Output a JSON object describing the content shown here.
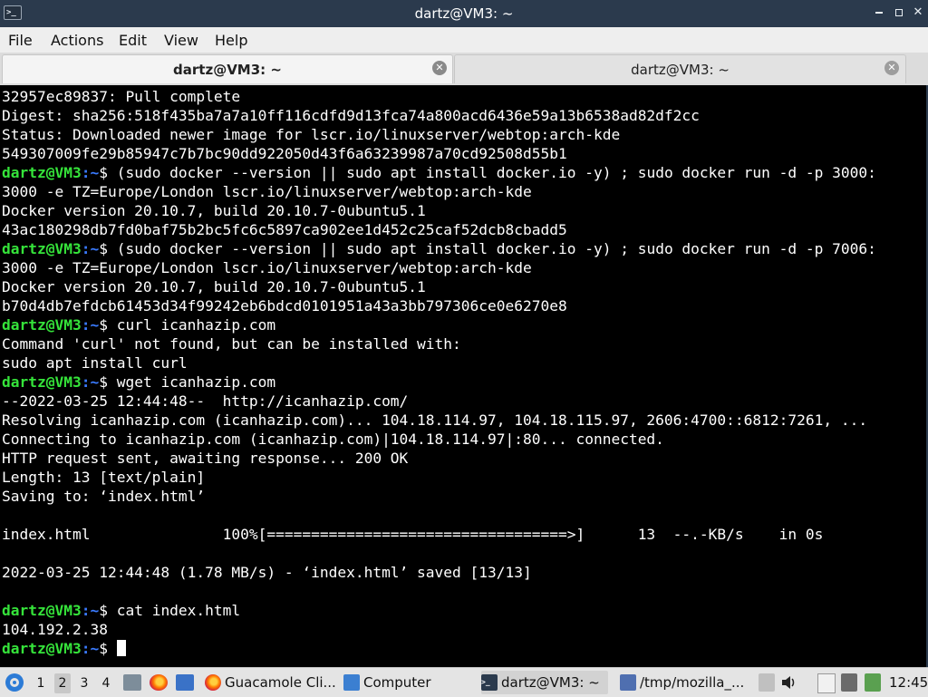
{
  "window": {
    "title": "dartz@VM3: ~",
    "app_icon_text": ">_",
    "controls": [
      "minimize-icon",
      "maximize-icon",
      "close-icon"
    ]
  },
  "menu": {
    "items": [
      "File",
      "Actions",
      "Edit",
      "View",
      "Help"
    ]
  },
  "tabs": [
    {
      "label": "dartz@VM3: ~",
      "active": true
    },
    {
      "label": "dartz@VM3: ~",
      "active": false
    }
  ],
  "terminal": {
    "colors": {
      "prompt_user": "#35e33a",
      "prompt_path": "#3a7bff",
      "text": "#ffffff",
      "background": "#000000"
    },
    "lines": [
      {
        "type": "out",
        "text": "32957ec89837: Pull complete"
      },
      {
        "type": "out",
        "text": "Digest: sha256:518f435ba7a7a10ff116cdfd9d13fca74a800acd6436e59a13b6538ad82df2cc"
      },
      {
        "type": "out",
        "text": "Status: Downloaded newer image for lscr.io/linuxserver/webtop:arch-kde"
      },
      {
        "type": "out",
        "text": "549307009fe29b85947c7b7bc90dd922050d43f6a63239987a70cd92508d55b1"
      },
      {
        "type": "prompt",
        "user": "dartz@VM3",
        "path": ":~",
        "cmd": "$ (sudo docker --version || sudo apt install docker.io -y) ; sudo docker run -d -p 3000:"
      },
      {
        "type": "out",
        "text": "3000 -e TZ=Europe/London lscr.io/linuxserver/webtop:arch-kde"
      },
      {
        "type": "out",
        "text": "Docker version 20.10.7, build 20.10.7-0ubuntu5.1"
      },
      {
        "type": "out",
        "text": "43ac180298db7fd0baf75b2bc5fc6c5897ca902ee1d452c25caf52dcb8cbadd5"
      },
      {
        "type": "prompt",
        "user": "dartz@VM3",
        "path": ":~",
        "cmd": "$ (sudo docker --version || sudo apt install docker.io -y) ; sudo docker run -d -p 7006:"
      },
      {
        "type": "out",
        "text": "3000 -e TZ=Europe/London lscr.io/linuxserver/webtop:arch-kde"
      },
      {
        "type": "out",
        "text": "Docker version 20.10.7, build 20.10.7-0ubuntu5.1"
      },
      {
        "type": "out",
        "text": "b70d4db7efdcb61453d34f99242eb6bdcd0101951a43a3bb797306ce0e6270e8"
      },
      {
        "type": "prompt",
        "user": "dartz@VM3",
        "path": ":~",
        "cmd": "$ curl icanhazip.com"
      },
      {
        "type": "out",
        "text": "Command 'curl' not found, but can be installed with:"
      },
      {
        "type": "out",
        "text": "sudo apt install curl"
      },
      {
        "type": "prompt",
        "user": "dartz@VM3",
        "path": ":~",
        "cmd": "$ wget icanhazip.com"
      },
      {
        "type": "out",
        "text": "--2022-03-25 12:44:48--  http://icanhazip.com/"
      },
      {
        "type": "out",
        "text": "Resolving icanhazip.com (icanhazip.com)... 104.18.114.97, 104.18.115.97, 2606:4700::6812:7261, ..."
      },
      {
        "type": "out",
        "text": "Connecting to icanhazip.com (icanhazip.com)|104.18.114.97|:80... connected."
      },
      {
        "type": "out",
        "text": "HTTP request sent, awaiting response... 200 OK"
      },
      {
        "type": "out",
        "text": "Length: 13 [text/plain]"
      },
      {
        "type": "out",
        "text": "Saving to: ‘index.html’"
      },
      {
        "type": "out",
        "text": ""
      },
      {
        "type": "out",
        "text": "index.html               100%[==================================>]      13  --.-KB/s    in 0s"
      },
      {
        "type": "out",
        "text": ""
      },
      {
        "type": "out",
        "text": "2022-03-25 12:44:48 (1.78 MB/s) - ‘index.html’ saved [13/13]"
      },
      {
        "type": "out",
        "text": ""
      },
      {
        "type": "prompt",
        "user": "dartz@VM3",
        "path": ":~",
        "cmd": "$ cat index.html"
      },
      {
        "type": "out",
        "text": "104.192.2.38"
      },
      {
        "type": "prompt",
        "user": "dartz@VM3",
        "path": ":~",
        "cmd": "$ ",
        "cursor": true
      }
    ]
  },
  "taskbar": {
    "workspaces": [
      "1",
      "2",
      "3",
      "4"
    ],
    "active_workspace": "2",
    "launchers": [
      "files-icon",
      "firefox-icon",
      "window-icon"
    ],
    "tasks": [
      {
        "label": "Guacamole Cli...",
        "icon": "firefox-icon"
      },
      {
        "label": "Computer",
        "icon": "folder-icon"
      },
      {
        "label": "dartz@VM3: ~",
        "icon": "terminal-icon",
        "active": true
      },
      {
        "label": "/tmp/mozilla_...",
        "icon": "text-editor-icon"
      }
    ],
    "tray_icons": [
      "tray-button-icon",
      "volume-icon",
      "clipboard-icon",
      "display-icon",
      "network-icon"
    ],
    "clock": "12:45"
  }
}
